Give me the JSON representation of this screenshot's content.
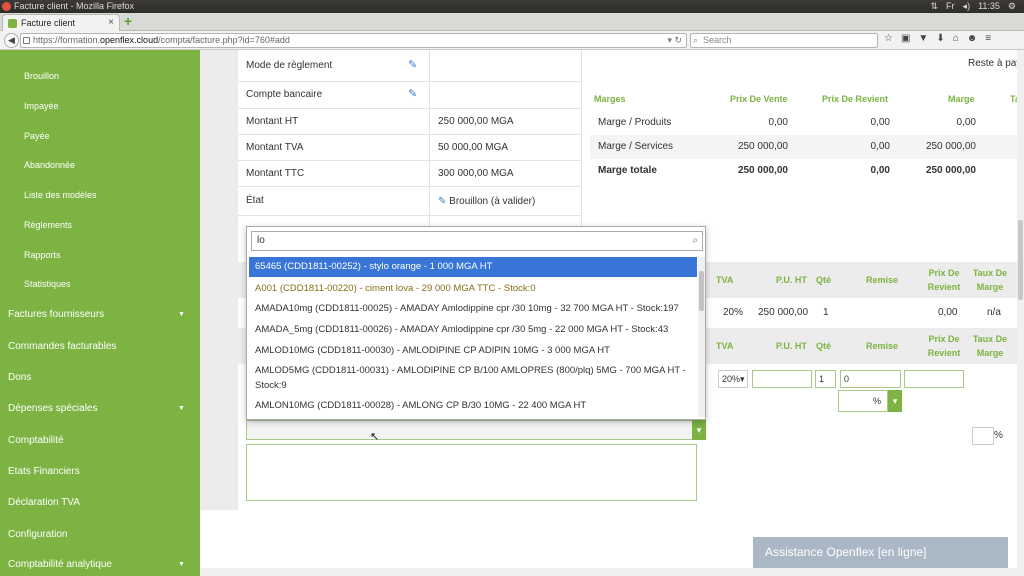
{
  "os": {
    "window_title": "Facture client - Mozilla Firefox",
    "tray": [
      "⇅",
      "Fr",
      "◂)",
      "11:35",
      "⚙"
    ]
  },
  "browser": {
    "tab_title": "Facture client",
    "url_prefix": "https://formation.",
    "url_host": "openflex.cloud",
    "url_path": "/compta/facture.php?id=760#add",
    "search_placeholder": "Search",
    "icons": [
      "☆",
      "▣",
      "▼",
      "⬇",
      "⌂",
      "☻",
      "≡"
    ]
  },
  "sidebar": {
    "sub_items": [
      "Brouillon",
      "Impayée",
      "Payée",
      "Abandonnée",
      "Liste des modèles",
      "Règlements",
      "Rapports",
      "Statistiques"
    ],
    "main_items": [
      {
        "label": "Factures fournisseurs",
        "arrow": "▼"
      },
      {
        "label": "Commandes facturables",
        "arrow": ""
      },
      {
        "label": "Dons",
        "arrow": ""
      },
      {
        "label": "Dépenses spéciales",
        "arrow": "▼"
      },
      {
        "label": "Comptabilité",
        "arrow": ""
      },
      {
        "label": "Etats Financiers",
        "arrow": ""
      },
      {
        "label": "Déclaration TVA",
        "arrow": ""
      },
      {
        "label": "Configuration",
        "arrow": ""
      },
      {
        "label": "Comptabilité analytique",
        "arrow": "▼"
      }
    ]
  },
  "info": {
    "rows": [
      {
        "label": "Mode de règlement",
        "value": ""
      },
      {
        "label": "Compte bancaire",
        "value": ""
      },
      {
        "label": "Montant HT",
        "value": "250 000,00 MGA"
      },
      {
        "label": "Montant TVA",
        "value": "50 000,00 MGA"
      },
      {
        "label": "Montant TTC",
        "value": "300 000,00 MGA"
      },
      {
        "label": "État",
        "value": "Brouillon (à valider)"
      }
    ]
  },
  "reste": "Reste à payer",
  "marges": {
    "headers": [
      "Marges",
      "Prix De Vente",
      "Prix De Revient",
      "Marge",
      "Taux"
    ],
    "rows": [
      {
        "label": "Marge / Produits",
        "vente": "0,00",
        "revient": "0,00",
        "marge": "0,00"
      },
      {
        "label": "Marge / Services",
        "vente": "250 000,00",
        "revient": "0,00",
        "marge": "250 000,00"
      },
      {
        "label": "Marge totale",
        "vente": "250 000,00",
        "revient": "0,00",
        "marge": "250 000,00"
      }
    ]
  },
  "products": {
    "headers": [
      "TVA",
      "P.U. HT",
      "Qté",
      "Remise",
      "Prix De\nRevient",
      "Taux De\nMarge"
    ],
    "line": {
      "tva": "20%",
      "pu": "250 000,00",
      "qte": "1",
      "revient": "0,00",
      "taux": "n/a"
    },
    "add": {
      "tva": "20%",
      "qte": "1",
      "remise": "0",
      "percent": "%"
    }
  },
  "dropdown": {
    "query": "lo",
    "options": [
      "65465 (CDD1811-00252) - stylo orange - 1 000 MGA HT",
      "A001 (CDD1811-00220) - ciment lova - 29 000 MGA TTC - Stock:0",
      "AMADA10mg (CDD1811-00025) - AMADAY Amlodippine cpr /30 10mg - 32 700 MGA HT - Stock:197",
      "AMADA_5mg (CDD1811-00026) - AMADAY Amlodippine cpr /30 5mg - 22 000 MGA HT - Stock:43",
      "AMLOD10MG (CDD1811-00030) - AMLODIPINE CP ADIPIN 10MG - 3 000 MGA HT",
      "AMLOD5MG (CDD1811-00031) - AMLODIPINE CP B/100 AMLOPRES (800/plq) 5MG - 700 MGA HT -",
      "Stock:9",
      "AMLON10MG (CDD1811-00028) - AMLONG CP B/30 10MG - 22 400 MGA HT"
    ]
  },
  "percent_label": "%",
  "assistance": "Assistance Openflex [en ligne]",
  "colors": {
    "accent": "#7cb342",
    "highlight": "#3875d7"
  }
}
